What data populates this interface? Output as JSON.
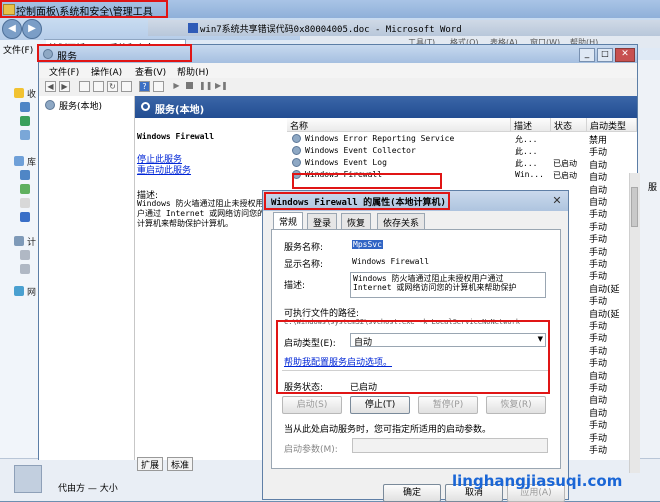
{
  "explorer": {
    "title": "控制面板\\系统和安全\\管理工具",
    "breadcrumb": [
      "控制面板",
      "系统和安全"
    ],
    "menu_label": "文件(F)",
    "organize_label": "组织",
    "left_items": [
      "收",
      "库",
      "计",
      "网"
    ],
    "bottom_text": "代由方 — 大小"
  },
  "word": {
    "title": "win7系统共享错误代码0x80004005.doc - Microsoft Word",
    "menu": [
      "帮助(H)",
      "工具(T)",
      "格式(O)",
      "表格(A)",
      "窗口(W)",
      "帮助(H)"
    ]
  },
  "services": {
    "title": "服务",
    "menu": [
      "文件(F)",
      "操作(A)",
      "查看(V)",
      "帮助(H)"
    ],
    "tree_item": "服务(本地)",
    "header": "服务(本地)",
    "detail": {
      "name": "Windows Firewall",
      "stop_link": "停止此服务",
      "restart_link": "重启动此服务",
      "desc_label": "描述:",
      "desc_text": "Windows 防火墙通过阻止未授权用户通过 Internet 或网络访问您的计算机来帮助保护计算机。"
    },
    "columns": [
      "名称",
      "描述",
      "状态",
      "启动类型"
    ],
    "rows": [
      {
        "name": "Windows Error Reporting Service",
        "desc": "允...",
        "status": "",
        "startup": "手动"
      },
      {
        "name": "Windows Event Collector",
        "desc": "此...",
        "status": "",
        "startup": "手动"
      },
      {
        "name": "Windows Event Log",
        "desc": "此...",
        "status": "已启动",
        "startup": "自动"
      },
      {
        "name": "Windows Firewall",
        "desc": "Win...",
        "status": "已启动",
        "startup": "自动"
      }
    ],
    "right_startup_col": [
      "禁用",
      "手动",
      "自动",
      "自动",
      "自动",
      "自动",
      "手动",
      "手动",
      "手动",
      "手动",
      "手动",
      "手动",
      "自动(延",
      "手动",
      "自动(延",
      "手动",
      "手动",
      "手动",
      "手动",
      "自动",
      "手动",
      "自动",
      "自动",
      "手动",
      "手动",
      "手动"
    ],
    "side_label": "服",
    "bottom_tabs": [
      "扩展",
      "标准"
    ]
  },
  "dialog": {
    "title": "Windows Firewall 的属性(本地计算机)",
    "tabs": [
      "常规",
      "登录",
      "恢复",
      "依存关系"
    ],
    "service_name_label": "服务名称:",
    "service_name": "MpsSvc",
    "display_name_label": "显示名称:",
    "display_name": "Windows Firewall",
    "desc_label": "描述:",
    "desc_text": "Windows 防火墙通过阻止未授权用户通过 Internet 或网络访问您的计算机来帮助保护",
    "exe_path_label": "可执行文件的路径:",
    "exe_path": "C:\\Windows\\system32\\svchost.exe -k LocalServiceNoNetwork",
    "startup_type_label": "启动类型(E):",
    "startup_type_value": "自动",
    "help_link": "帮助我配置服务启动选项。",
    "status_label": "服务状态:",
    "status_value": "已启动",
    "buttons": {
      "start": "启动(S)",
      "stop": "停止(T)",
      "pause": "暂停(P)",
      "resume": "恢复(R)"
    },
    "start_params_note": "当从此处启动服务时，您可指定所适用的启动参数。",
    "start_params_label": "启动参数(M):",
    "ok": "确定",
    "cancel": "取消",
    "apply": "应用(A)"
  },
  "watermark": "linghangjiasuqi.com",
  "colors": {
    "highlight": "#e01515",
    "header_blue": "#2a55a0"
  }
}
